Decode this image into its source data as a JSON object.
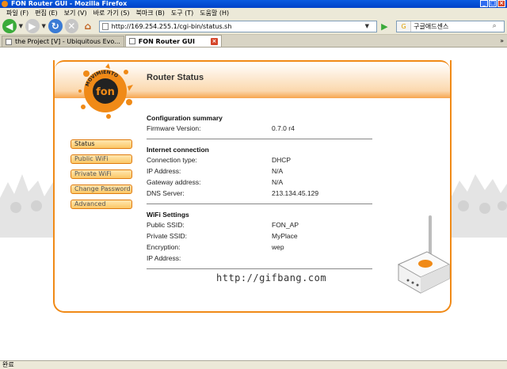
{
  "window": {
    "title": "FON Router GUI - Mozilla Firefox"
  },
  "menu": [
    "파일 (F)",
    "편집 (E)",
    "보기 (V)",
    "바로 가기 (S)",
    "북마크 (B)",
    "도구 (T)",
    "도움말 (H)"
  ],
  "toolbar": {
    "url": "http://169.254.255.1/cgi-bin/status.sh",
    "search_value": "구글애드센스"
  },
  "tabs": [
    {
      "label": "the Project [V] - Ubiquitous Evo..."
    },
    {
      "label": "FON Router GUI"
    }
  ],
  "page": {
    "title": "Router Status",
    "nav": [
      "Status",
      "Public WiFi",
      "Private WiFi",
      "Change Password",
      "Advanced"
    ],
    "sections": [
      {
        "heading": "Configuration summary",
        "rows": [
          {
            "label": "Firmware Version:",
            "value": "0.7.0 r4"
          }
        ]
      },
      {
        "heading": "Internet connection",
        "rows": [
          {
            "label": "Connection type:",
            "value": "DHCP"
          },
          {
            "label": "IP Address:",
            "value": "N/A"
          },
          {
            "label": "Gateway address:",
            "value": "N/A"
          },
          {
            "label": "DNS Server:",
            "value": "213.134.45.129"
          }
        ]
      },
      {
        "heading": "WiFi Settings",
        "rows": [
          {
            "label": "Public SSID:",
            "value": "FON_AP"
          },
          {
            "label": "Private SSID:",
            "value": "MyPlace"
          },
          {
            "label": "Encryption:",
            "value": "wep"
          },
          {
            "label": "IP Address:",
            "value": ""
          }
        ]
      }
    ],
    "watermark": "http://gifbang.com",
    "logo_text": "fon",
    "logo_ring": "MOVIMIENTO"
  },
  "status": {
    "text": "완료"
  },
  "colors": {
    "accent": "#f08a17",
    "nav_fill": "#fbc766"
  }
}
